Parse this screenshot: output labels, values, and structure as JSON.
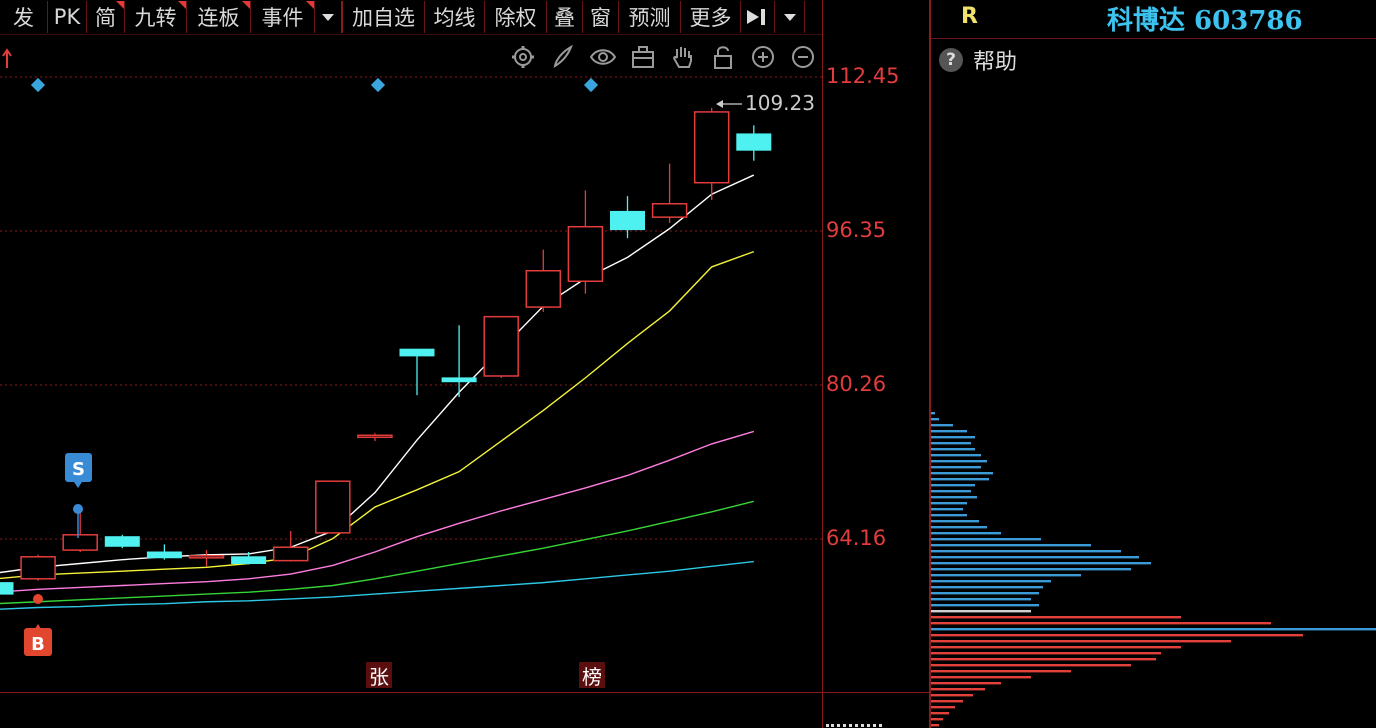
{
  "toolbar": {
    "items": [
      {
        "label": "发",
        "flag": false
      },
      {
        "label": "PK",
        "flag": false
      },
      {
        "label": "简",
        "flag": true
      },
      {
        "label": "九转",
        "flag": true
      },
      {
        "label": "连板",
        "flag": true
      },
      {
        "label": "事件",
        "flag": true
      }
    ],
    "items2": [
      "加自选",
      "均线",
      "除权",
      "叠",
      "窗",
      "预测",
      "更多"
    ]
  },
  "chart_tools": [
    "settings-icon",
    "brush-icon",
    "eye-icon",
    "toolbox-icon",
    "hand-icon",
    "lock-icon",
    "zoom-in-icon",
    "zoom-out-icon"
  ],
  "price_ticks": [
    "112.45",
    "96.35",
    "80.26",
    "64.16"
  ],
  "max_price_label": "109.23",
  "signals": {
    "buy": "B",
    "sell": "S"
  },
  "bottom_tags": [
    "张",
    "榜"
  ],
  "right_panel": {
    "r_label": "R",
    "title": "科博达 603786",
    "help_label": "帮助"
  },
  "colors": {
    "up": "#e23c3c",
    "down": "#4ff0f0",
    "ma5": "#ffffff",
    "ma10": "#f2f23a",
    "ma20": "#ff7de0",
    "ma30": "#36d436",
    "ma60": "#2cc8e6",
    "grid": "#8a1b1b",
    "accent_title": "#3cc3f0"
  },
  "chart_data": {
    "type": "candlestick",
    "ylim": [
      52.5,
      116
    ],
    "y_ticks": [
      112.45,
      96.35,
      80.26,
      64.16
    ],
    "candles": [
      {
        "o": 59.6,
        "c": 58.4,
        "h": 60.0,
        "l": 58.2
      },
      {
        "o": 60.0,
        "c": 62.3,
        "h": 62.5,
        "l": 59.8
      },
      {
        "o": 63.0,
        "c": 64.6,
        "h": 67.0,
        "l": 62.8
      },
      {
        "o": 64.4,
        "c": 63.4,
        "h": 64.6,
        "l": 63.2
      },
      {
        "o": 62.8,
        "c": 62.2,
        "h": 63.6,
        "l": 62.0
      },
      {
        "o": 62.4,
        "c": 62.4,
        "h": 63.0,
        "l": 61.3
      },
      {
        "o": 62.3,
        "c": 61.6,
        "h": 62.8,
        "l": 61.5
      },
      {
        "o": 61.9,
        "c": 63.3,
        "h": 65.0,
        "l": 61.8
      },
      {
        "o": 64.8,
        "c": 70.2,
        "h": 70.2,
        "l": 64.8
      },
      {
        "o": 75.0,
        "c": 75.0,
        "h": 75.2,
        "l": 74.4
      },
      {
        "o": 84.0,
        "c": 83.3,
        "h": 84.0,
        "l": 79.2
      },
      {
        "o": 81.0,
        "c": 80.6,
        "h": 86.5,
        "l": 79.0
      },
      {
        "o": 81.2,
        "c": 87.4,
        "h": 87.4,
        "l": 81.0
      },
      {
        "o": 88.4,
        "c": 92.2,
        "h": 94.4,
        "l": 87.9
      },
      {
        "o": 91.1,
        "c": 96.8,
        "h": 100.6,
        "l": 89.8
      },
      {
        "o": 98.4,
        "c": 96.5,
        "h": 100.0,
        "l": 95.6
      },
      {
        "o": 97.8,
        "c": 99.2,
        "h": 103.4,
        "l": 97.2
      },
      {
        "o": 101.4,
        "c": 108.8,
        "h": 109.23,
        "l": 99.6
      },
      {
        "o": 106.5,
        "c": 104.8,
        "h": 107.4,
        "l": 103.7
      }
    ],
    "series": [
      {
        "name": "",
        "color": "#ffffff",
        "values": [
          60.6,
          61.2,
          61.6,
          62.0,
          62.3,
          62.5,
          62.6,
          63.3,
          65.0,
          69.0,
          74.5,
          79.5,
          84.0,
          88.5,
          91.4,
          93.6,
          96.6,
          100.2,
          102.2
        ]
      },
      {
        "name": "",
        "color": "#f2f23a",
        "values": [
          60.0,
          60.4,
          60.6,
          60.8,
          61.0,
          61.2,
          61.6,
          62.2,
          64.2,
          67.5,
          69.3,
          71.2,
          74.4,
          77.6,
          81.0,
          84.6,
          88.0,
          92.6,
          94.2
        ]
      },
      {
        "name": "",
        "color": "#ff7de0",
        "values": [
          58.6,
          58.9,
          59.1,
          59.3,
          59.5,
          59.7,
          60.0,
          60.5,
          61.4,
          62.8,
          64.4,
          65.8,
          67.1,
          68.3,
          69.5,
          70.8,
          72.4,
          74.1,
          75.4
        ]
      },
      {
        "name": "",
        "color": "#36d436",
        "values": [
          57.4,
          57.6,
          57.8,
          58.0,
          58.2,
          58.4,
          58.6,
          58.9,
          59.3,
          60.0,
          60.8,
          61.6,
          62.4,
          63.2,
          64.1,
          65.0,
          66.0,
          67.0,
          68.1
        ]
      },
      {
        "name": "",
        "color": "#2cc8e6",
        "values": [
          56.8,
          57.0,
          57.1,
          57.3,
          57.4,
          57.6,
          57.7,
          57.9,
          58.1,
          58.4,
          58.7,
          59.0,
          59.3,
          59.6,
          60.0,
          60.4,
          60.8,
          61.3,
          61.8
        ]
      }
    ],
    "volume_profile": {
      "note": "",
      "y_range": [
        53.0,
        75.5
      ]
    }
  }
}
